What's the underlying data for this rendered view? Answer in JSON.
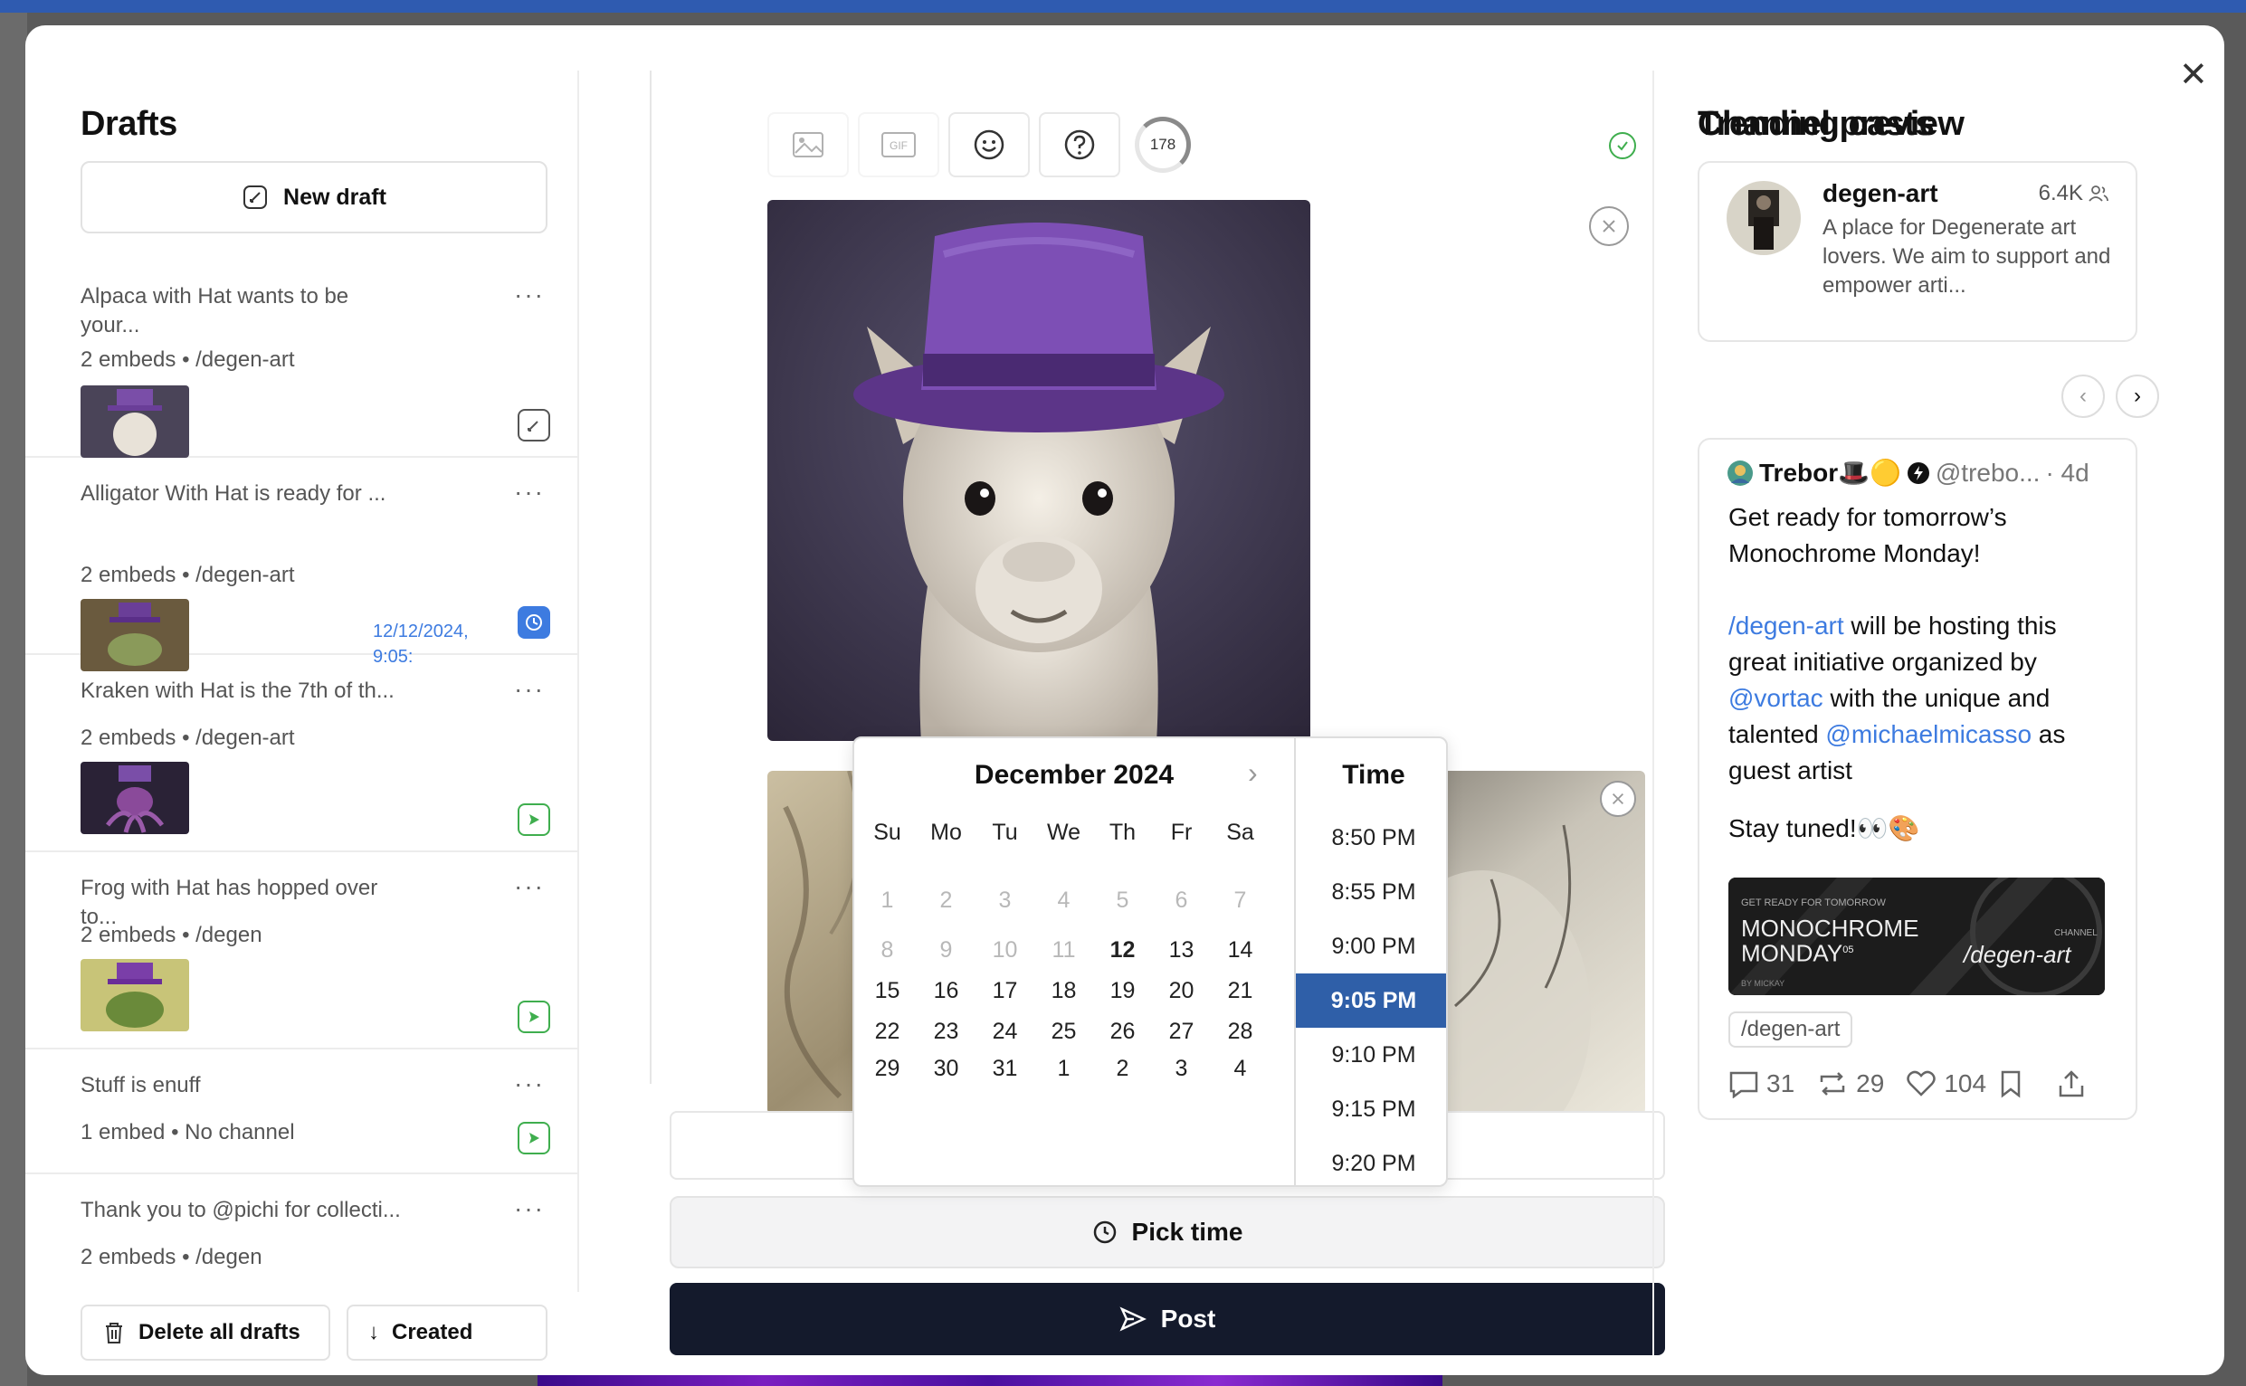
{
  "drafts": {
    "title": "Drafts",
    "new_draft_label": "New draft",
    "items": [
      {
        "title": "Alpaca with Hat wants to be your...",
        "meta": "2 embeds • /degen-art",
        "status": "edit"
      },
      {
        "title": "Alligator With Hat is ready for ...",
        "meta": "2 embeds • /degen-art",
        "scheduled": "12/12/2024, 9:05:",
        "status": "scheduled"
      },
      {
        "title": "Kraken with Hat is the 7th of th...",
        "meta": "2 embeds • /degen-art",
        "status": "send"
      },
      {
        "title": "Frog with Hat has hopped over to...",
        "meta": "2 embeds • /degen",
        "status": "send"
      },
      {
        "title": "Stuff is enuff",
        "meta": "1 embed • No channel",
        "status": "send"
      },
      {
        "title": "Thank you to @pichi for collecti...",
        "meta": "2 embeds • /degen",
        "status": "send"
      }
    ],
    "delete_all_label": "Delete all drafts",
    "sort_label": "Created"
  },
  "composer": {
    "char_counter": "178",
    "pick_time_label": "Pick time",
    "post_label": "Post"
  },
  "datepicker": {
    "month_label": "December 2024",
    "weekdays": [
      "Su",
      "Mo",
      "Tu",
      "We",
      "Th",
      "Fr",
      "Sa"
    ],
    "weeks": [
      [
        "1",
        "2",
        "3",
        "4",
        "5",
        "6",
        "7"
      ],
      [
        "8",
        "9",
        "10",
        "11",
        "12",
        "13",
        "14"
      ],
      [
        "15",
        "16",
        "17",
        "18",
        "19",
        "20",
        "21"
      ],
      [
        "22",
        "23",
        "24",
        "25",
        "26",
        "27",
        "28"
      ],
      [
        "29",
        "30",
        "31",
        "1",
        "2",
        "3",
        "4"
      ]
    ],
    "time_title": "Time",
    "times": [
      "8:50 PM",
      "8:55 PM",
      "9:00 PM",
      "9:05 PM",
      "9:10 PM",
      "9:15 PM",
      "9:20 PM"
    ],
    "selected_time": "9:05 PM",
    "selected_day": "12"
  },
  "channel_preview": {
    "title": "Channel preview",
    "name": "degen-art",
    "members": "6.4K",
    "description": "A place for Degenerate art lovers. We aim to support and empower arti..."
  },
  "trending": {
    "title": "Trending casts",
    "cast": {
      "author": "Trebor🎩🟡",
      "handle": "@trebo...",
      "age": "· 4d",
      "line1": "Get ready for tomorrow’s Monochrome Monday!",
      "link_channel": "/degen-art",
      "line2": " will be hosting this great initiative organized by ",
      "link_user1": "@vortac",
      "line3": " with the unique and talented ",
      "link_user2": "@michaelmicasso",
      "line4": " as guest artist",
      "line5": "Stay tuned!👀🎨",
      "image_kicker": "GET READY FOR TOMORROW",
      "image_title1": "MONOCHROME",
      "image_title2": "MONDAY",
      "image_sup": "05",
      "image_channel": "/degen-art",
      "image_channel_small": "CHANNEL",
      "image_byline": "BY MICKAY",
      "tag": "/degen-art",
      "replies": "31",
      "recasts": "29",
      "likes": "104"
    }
  },
  "colors": {
    "accent_blue": "#3d7be0",
    "selected_time_bg": "#2f5fa8",
    "post_button_bg": "#141a2c",
    "success_green": "#3fae4e",
    "top_bar": "#2f5bb0"
  }
}
